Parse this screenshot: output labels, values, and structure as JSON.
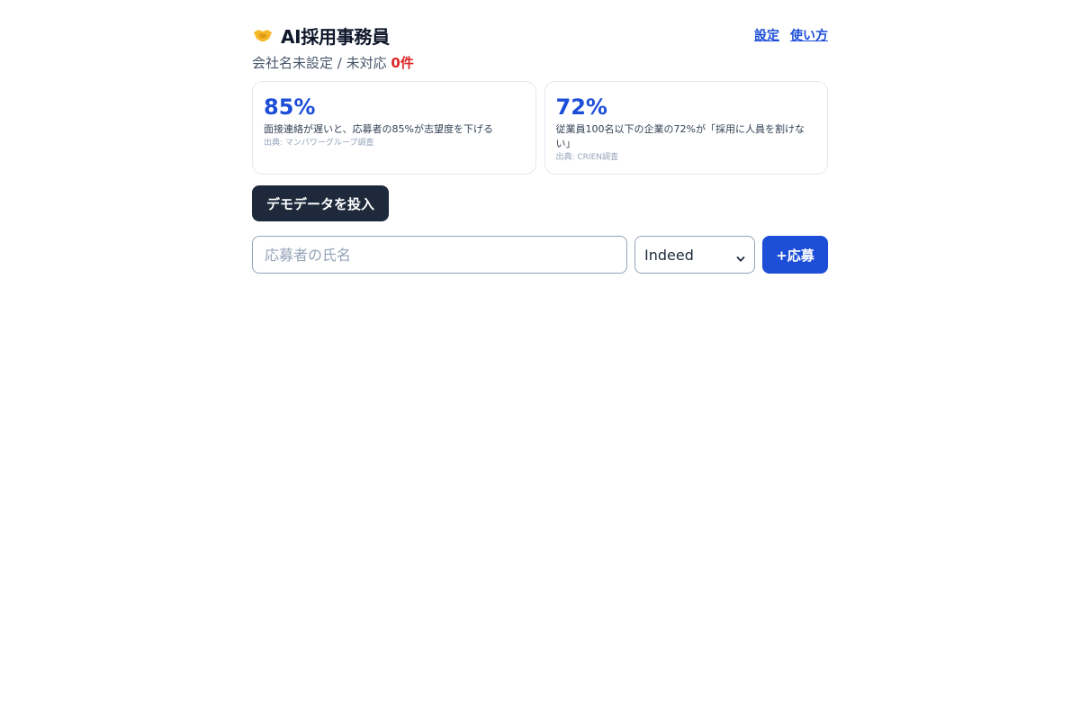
{
  "header": {
    "title": "AI採用事務員",
    "icon": "handshake-icon",
    "links": [
      "設定",
      "使い方"
    ]
  },
  "status": {
    "company": "会社名未設定",
    "separator": " / ",
    "pending_label": "未対応",
    "pending_count": "0件"
  },
  "stats": [
    {
      "value": "85%",
      "description": "面接連絡が遅いと、応募者の85%が志望度を下げる",
      "source": "出典: マンパワーグループ調査"
    },
    {
      "value": "72%",
      "description": "従業員100名以下の企業の72%が「採用に人員を割けない」",
      "source": "出典: CRIEN調査"
    }
  ],
  "demo_button_label": "デモデータを投入",
  "form": {
    "name_placeholder": "応募者の氏名",
    "name_value": "",
    "source_selected": "Indeed",
    "add_button_label": "+応募"
  },
  "colors": {
    "accent": "#1d4ed8",
    "dark": "#1e293b",
    "alert": "#dc2626"
  }
}
